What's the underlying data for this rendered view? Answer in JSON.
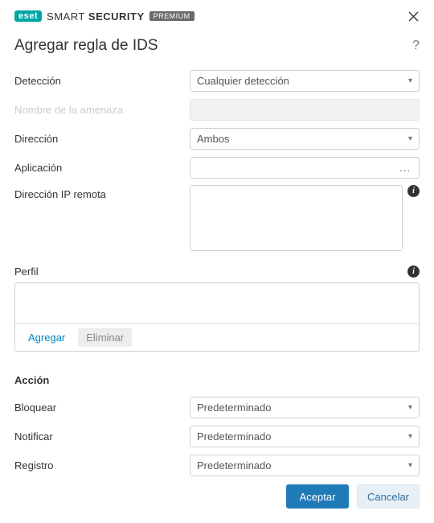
{
  "brand": {
    "eset": "eset",
    "smart": "SMART",
    "security": "SECURITY",
    "badge": "PREMIUM"
  },
  "header": {
    "title": "Agregar regla de IDS"
  },
  "labels": {
    "detection": "Detección",
    "threatName": "Nombre de la amenaza",
    "direction": "Dirección",
    "application": "Aplicación",
    "remoteIp": "Dirección IP remota",
    "profile": "Perfil",
    "action": "Acción",
    "block": "Bloquear",
    "notify": "Notificar",
    "log": "Registro"
  },
  "values": {
    "detection": "Cualquier detección",
    "direction": "Ambos",
    "application": "",
    "remoteIp": "",
    "block": "Predeterminado",
    "notify": "Predeterminado",
    "log": "Predeterminado"
  },
  "buttons": {
    "add": "Agregar",
    "delete": "Eliminar",
    "accept": "Aceptar",
    "cancel": "Cancelar"
  },
  "icons": {
    "appMore": "..."
  }
}
